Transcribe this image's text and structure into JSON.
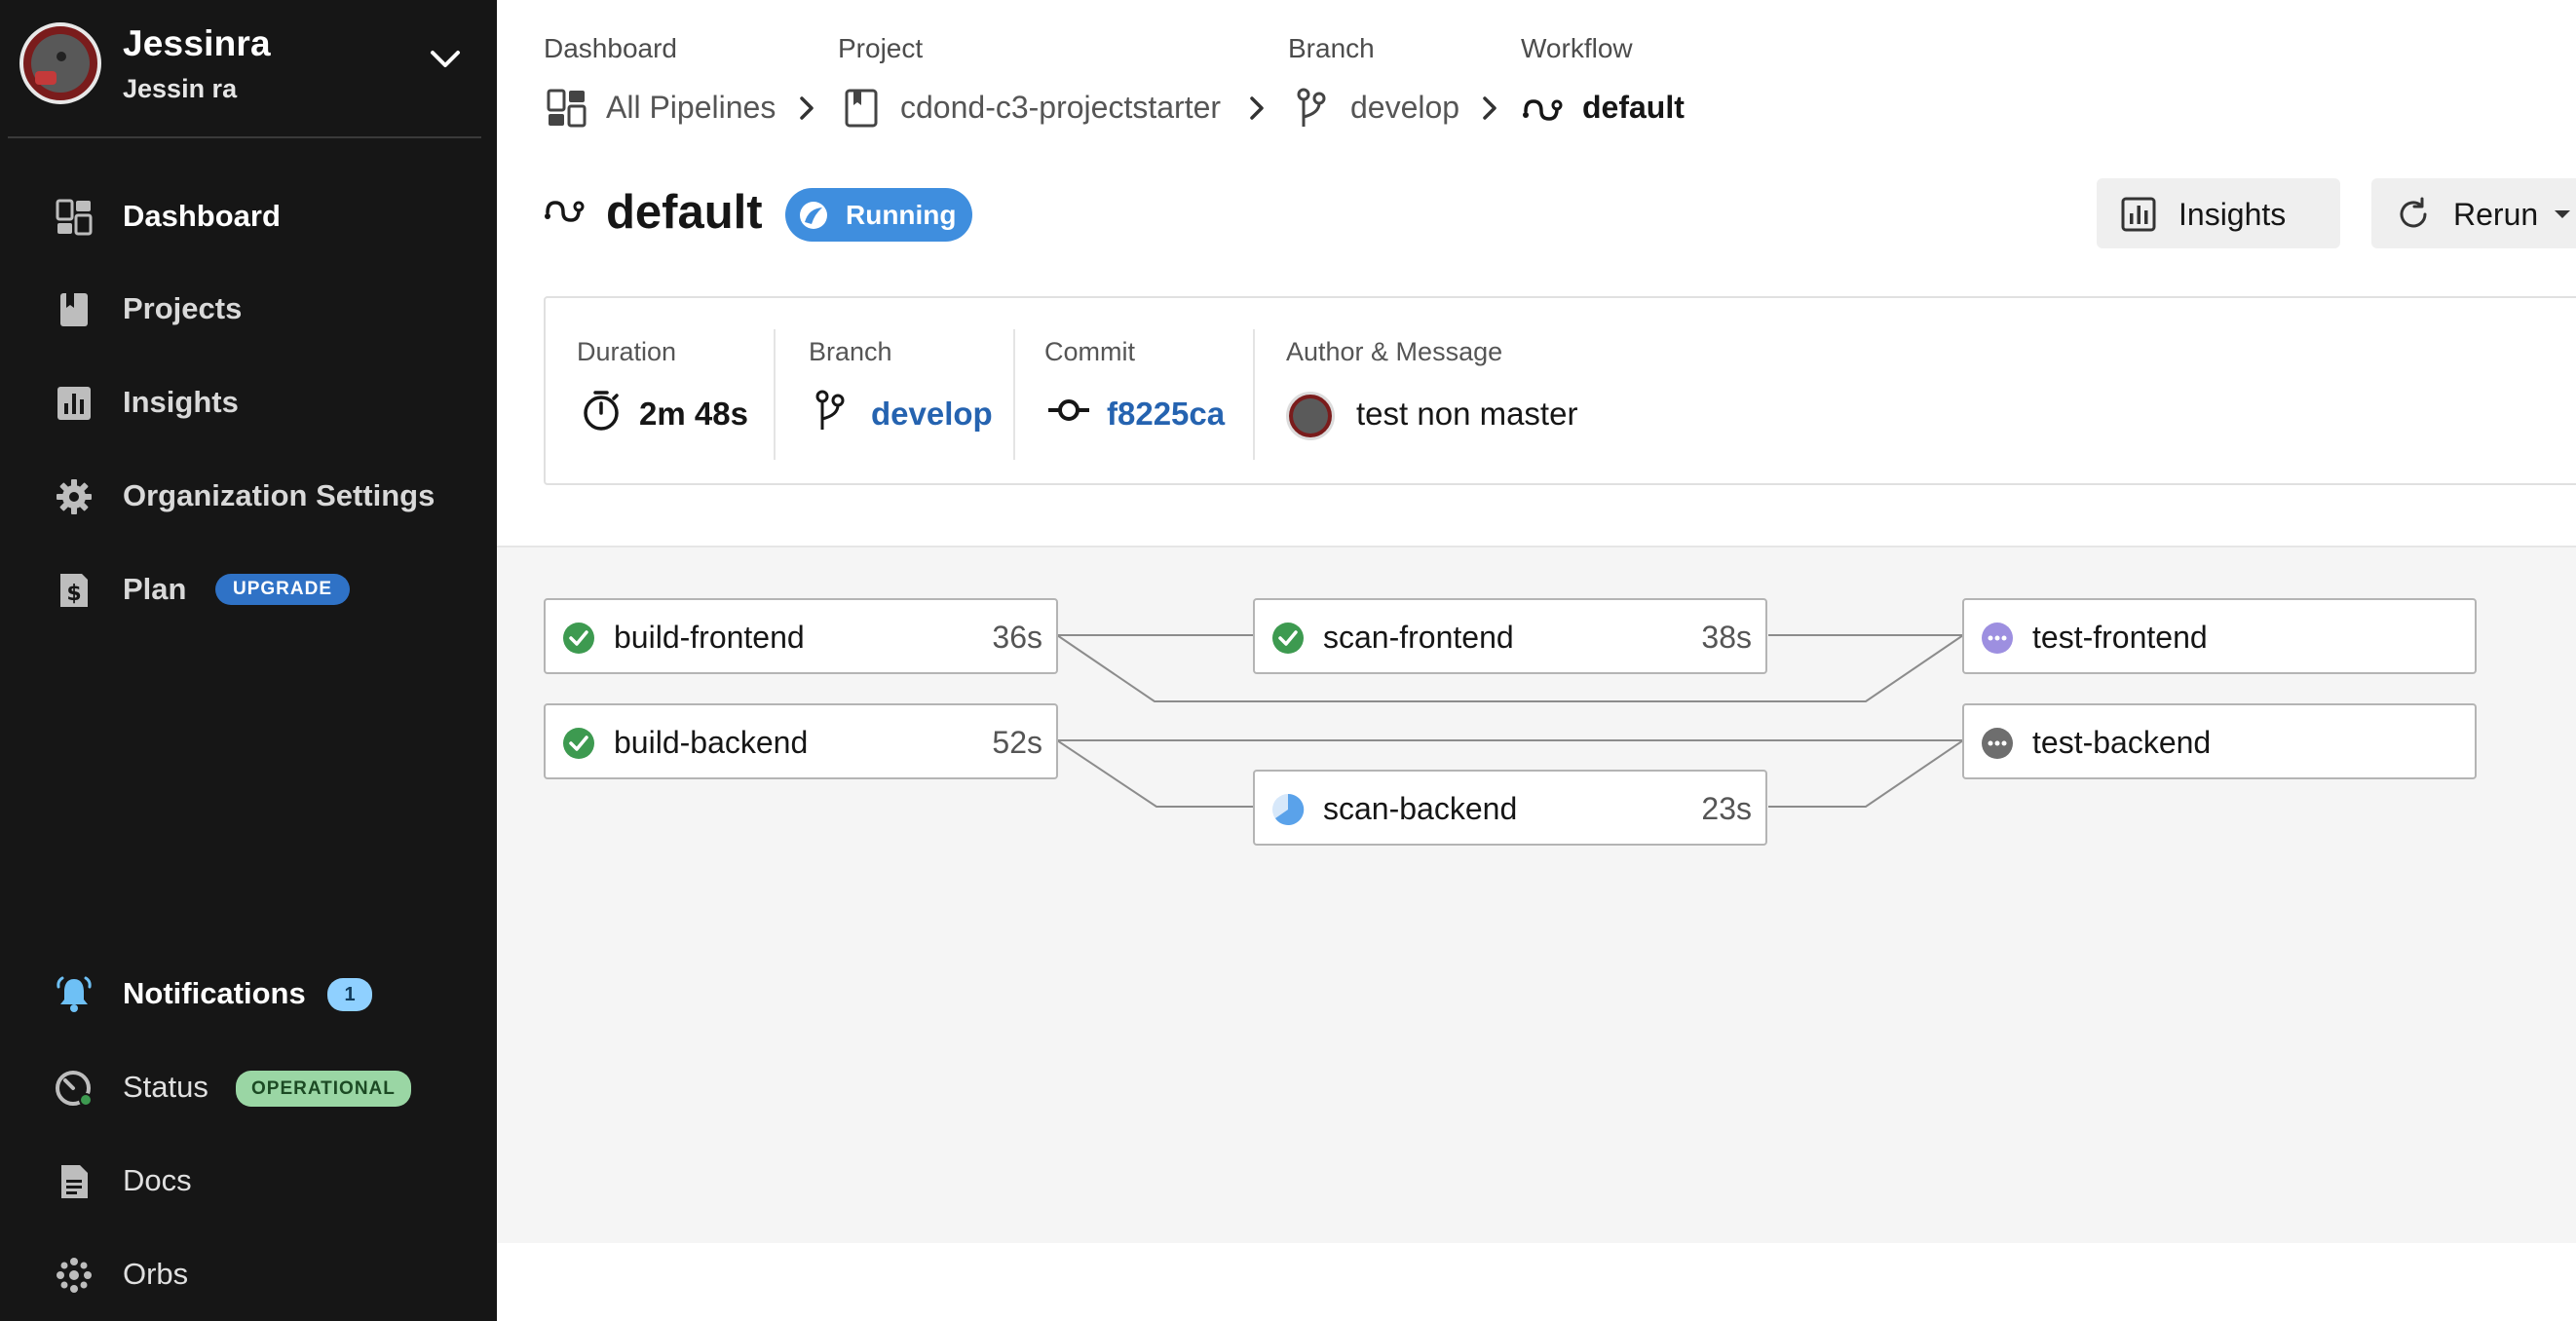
{
  "user": {
    "name": "Jessinra",
    "subname": "Jessin ra"
  },
  "sidebar": {
    "items": [
      {
        "label": "Dashboard",
        "icon": "dashboard-icon"
      },
      {
        "label": "Projects",
        "icon": "book-icon"
      },
      {
        "label": "Insights",
        "icon": "bar-chart-icon"
      },
      {
        "label": "Organization Settings",
        "icon": "gear-icon"
      },
      {
        "label": "Plan",
        "icon": "dollar-doc-icon",
        "badge": "UPGRADE"
      }
    ],
    "bottom": [
      {
        "label": "Notifications",
        "icon": "bell-icon",
        "badge": "1"
      },
      {
        "label": "Status",
        "icon": "gauge-icon",
        "badge": "OPERATIONAL"
      },
      {
        "label": "Docs",
        "icon": "document-icon"
      },
      {
        "label": "Orbs",
        "icon": "orbs-icon"
      }
    ]
  },
  "breadcrumb": {
    "dashboard": {
      "label": "Dashboard",
      "value": "All Pipelines"
    },
    "project": {
      "label": "Project",
      "value": "cdond-c3-projectstarter"
    },
    "branch": {
      "label": "Branch",
      "value": "develop"
    },
    "workflow": {
      "label": "Workflow",
      "value": "default"
    }
  },
  "header": {
    "title": "default",
    "status": "Running",
    "insights_label": "Insights",
    "rerun_label": "Rerun"
  },
  "summary": {
    "duration": {
      "label": "Duration",
      "value": "2m 48s"
    },
    "branch": {
      "label": "Branch",
      "value": "develop"
    },
    "commit": {
      "label": "Commit",
      "value": "f8225ca"
    },
    "author": {
      "label": "Author & Message",
      "message": "test non master"
    }
  },
  "jobs": [
    {
      "name": "build-frontend",
      "duration": "36s",
      "status": "success"
    },
    {
      "name": "scan-frontend",
      "duration": "38s",
      "status": "success"
    },
    {
      "name": "test-frontend",
      "duration": "",
      "status": "queued"
    },
    {
      "name": "build-backend",
      "duration": "52s",
      "status": "success"
    },
    {
      "name": "test-backend",
      "duration": "",
      "status": "blocked"
    },
    {
      "name": "scan-backend",
      "duration": "23s",
      "status": "running"
    }
  ],
  "colors": {
    "success": "#3d9a50",
    "running": "#3f8ede",
    "queued": "#9d8fe0",
    "blocked": "#6e6e6e",
    "link": "#2563b0",
    "sidebar_bg": "#161616"
  }
}
